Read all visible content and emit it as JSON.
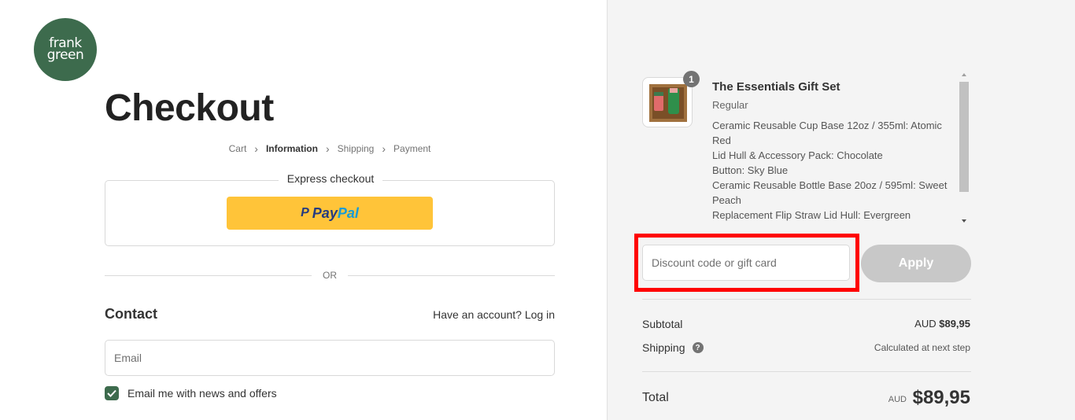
{
  "brand": {
    "line1": "frank",
    "line2": "green",
    "color": "#3d6b4d"
  },
  "page_title": "Checkout",
  "breadcrumb": [
    {
      "label": "Cart"
    },
    {
      "label": "Information"
    },
    {
      "label": "Shipping"
    },
    {
      "label": "Payment"
    }
  ],
  "express": {
    "title": "Express checkout",
    "paypal_a": "Pay",
    "paypal_b": "Pal",
    "paypal_icon": "P"
  },
  "divider_or": "OR",
  "contact": {
    "heading": "Contact",
    "account_prompt": "Have an account?",
    "login_link": "Log in",
    "email_placeholder": "Email",
    "newsletter_label": "Email me with news and offers",
    "newsletter_checked": true
  },
  "order": {
    "product": {
      "name": "The Essentials Gift Set",
      "variant": "Regular",
      "quantity": "1",
      "options": [
        "Ceramic Reusable Cup Base 12oz / 355ml: Atomic Red",
        "Lid Hull & Accessory Pack: Chocolate",
        "Button: Sky Blue",
        "Ceramic Reusable Bottle Base 20oz / 595ml: Sweet Peach",
        "Replacement Flip Straw Lid Hull: Evergreen"
      ]
    },
    "discount_placeholder": "Discount code or gift card",
    "apply_label": "Apply",
    "subtotal_label": "Subtotal",
    "subtotal_currency": "AUD",
    "subtotal_value": "$89,95",
    "shipping_label": "Shipping",
    "shipping_value": "Calculated at next step",
    "total_label": "Total",
    "total_currency": "AUD",
    "total_value": "$89,95"
  },
  "colors": {
    "accent": "#3d6b4d",
    "paypal_yellow": "#ffc439",
    "highlight": "#ff0000"
  }
}
